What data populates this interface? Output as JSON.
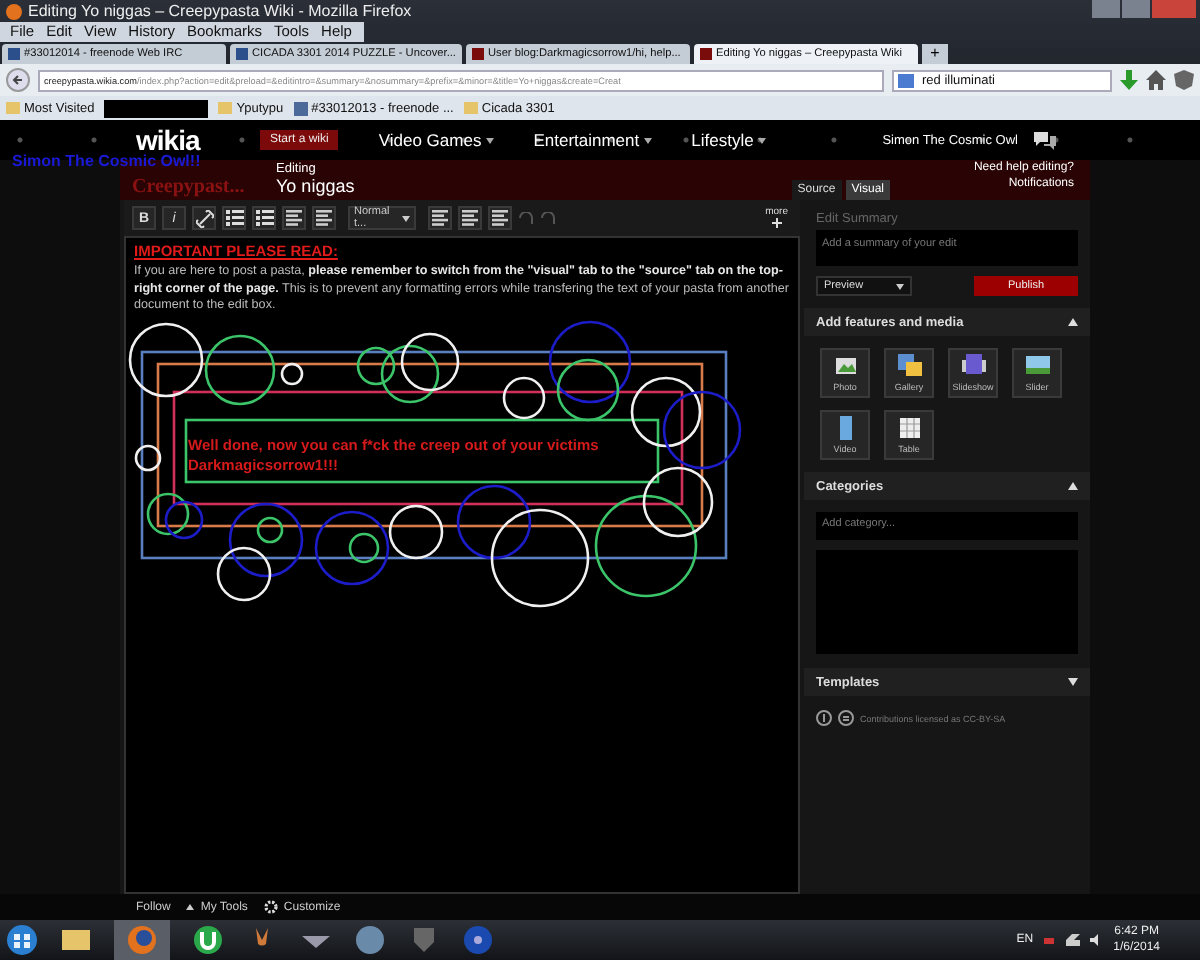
{
  "window": {
    "title": "Editing Yo niggas – Creepypasta Wiki - Mozilla Firefox"
  },
  "menu": [
    "File",
    "Edit",
    "View",
    "History",
    "Bookmarks",
    "Tools",
    "Help"
  ],
  "tabs": [
    {
      "label": "#33012014 - freenode Web IRC",
      "selected": false
    },
    {
      "label": "CICADA 3301 2014 PUZZLE - Uncover...",
      "selected": false
    },
    {
      "label": "User blog:Darkmagicsorrow1/hi, help...",
      "selected": false
    },
    {
      "label": "Editing Yo niggas – Creepypasta Wiki",
      "selected": true
    }
  ],
  "new_tab": "+",
  "address": {
    "host": "creepypasta.wikia.com",
    "path": "/index.php?action=edit&preload=&editintro=&summary=&nosummary=&prefix=&minor=&title=Yo+niggas&create=Creat"
  },
  "search": {
    "value": "red illuminati"
  },
  "bookmarks": [
    {
      "kind": "special",
      "label": "Most Visited"
    },
    {
      "kind": "redacted"
    },
    {
      "kind": "folder",
      "label": "Yputypu"
    },
    {
      "kind": "page",
      "label": "#33012013 - freenode ..."
    },
    {
      "kind": "folder",
      "label": "Cicada 3301"
    }
  ],
  "wikia_bar": {
    "logo": "wikia",
    "start_button": "Start a wiki",
    "nav": [
      "Video Games",
      "Entertainment",
      "Lifestyle"
    ],
    "user": "Simon The Cosmic Owl"
  },
  "overlay_text": "Simon The Cosmic Owl!!",
  "header": {
    "wiki_logo": "Creepypast...",
    "editing_label": "Editing",
    "page_title": "Yo niggas",
    "mode_tabs": [
      {
        "label": "Source",
        "selected": false
      },
      {
        "label": "Visual",
        "selected": true
      }
    ],
    "help_link": "Need help editing?",
    "notifications": "Notifications"
  },
  "toolbar": {
    "bold": "B",
    "italic": "i",
    "format_dropdown": "Normal t...",
    "more": "more"
  },
  "editor": {
    "notice_heading": "IMPORTANT PLEASE READ:",
    "notice_text": "If you are here to post a pasta, **please remember to switch from the \"visual\" tab to the \"source\" tab on the top-right corner of the page.** This is to prevent any formatting errors while transfering the text of your pasta from another document to the edit box.",
    "canvas_message": [
      "Well done, now you can f*ck the creep out of your victims",
      "Darkmagicsorrow1!!!"
    ]
  },
  "sidebar": {
    "summary_label": "Edit Summary",
    "summary_placeholder": "Add a summary of your edit",
    "preview_button": "Preview",
    "publish_button": "Publish",
    "sections": [
      {
        "kind": "media",
        "title": "Add features and media",
        "expanded": true,
        "items": [
          "Photo",
          "Gallery",
          "Slideshow",
          "Slider",
          "Video",
          "Table"
        ]
      },
      {
        "kind": "categories",
        "title": "Categories",
        "expanded": true,
        "placeholder": "Add category..."
      },
      {
        "title": "Templates",
        "expanded": false
      }
    ],
    "license": "Contributions licensed as CC-BY-SA"
  },
  "footer": [
    "Follow",
    "My Tools",
    "Customize"
  ],
  "taskbar": {
    "language": "EN",
    "time": "6:42 PM",
    "date": "1/6/2014"
  }
}
